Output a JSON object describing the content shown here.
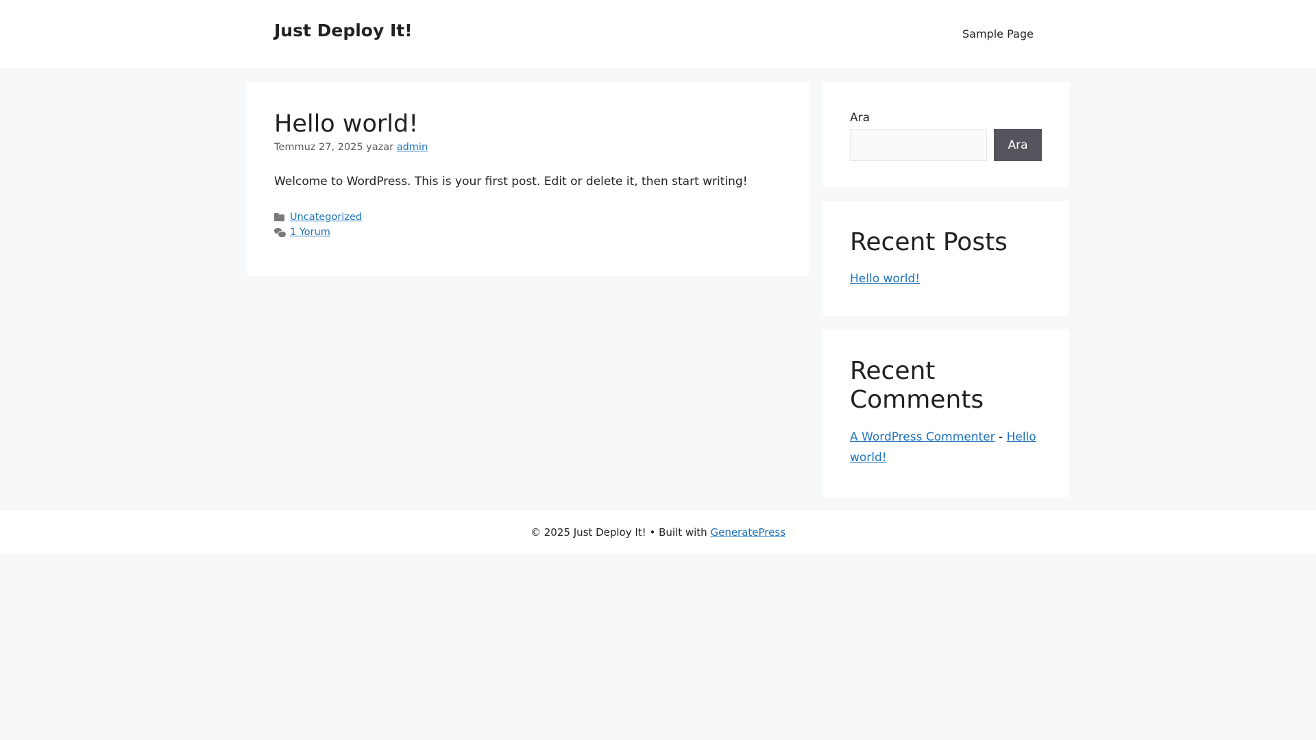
{
  "header": {
    "site_title": "Just Deploy It!",
    "nav_items": [
      "Sample Page"
    ]
  },
  "post": {
    "title": "Hello world!",
    "meta_date": "Temmuz 27, 2025",
    "meta_by": "yazar",
    "meta_author": "admin",
    "content": "Welcome to WordPress. This is your first post. Edit or delete it, then start writing!",
    "category": "Uncategorized",
    "comments_link": "1 Yorum"
  },
  "sidebar": {
    "search": {
      "label": "Ara",
      "placeholder": "",
      "button": "Ara"
    },
    "recent_posts": {
      "title": "Recent Posts",
      "items": [
        "Hello world!"
      ]
    },
    "recent_comments": {
      "title": "Recent Comments",
      "items": [
        {
          "author": "A WordPress Commenter",
          "separator": "-",
          "post": "Hello world!"
        }
      ]
    }
  },
  "footer": {
    "copyright": "© 2025 Just Deploy It! • Built with",
    "theme_link": "GeneratePress"
  },
  "colors": {
    "link": "#1e73be",
    "button_bg": "#55555e",
    "page_bg": "#f7f8f9"
  }
}
